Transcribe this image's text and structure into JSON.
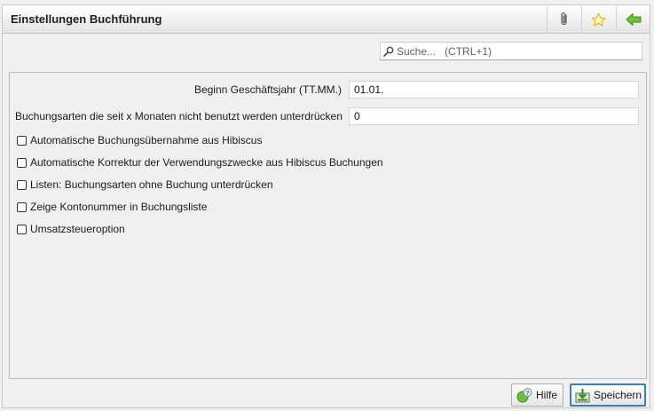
{
  "header": {
    "title": "Einstellungen Buchführung"
  },
  "icons": {
    "attach": "paperclip-icon",
    "bookmark": "star-icon",
    "back": "back-arrow-icon"
  },
  "search": {
    "placeholder": "Suche...   (CTRL+1)"
  },
  "form": {
    "fiscal_year_label": "Beginn Geschäftsjahr (TT.MM.)",
    "fiscal_year_value": "01.01.",
    "hide_unused_label": "Buchungsarten die seit x Monaten nicht benutzt werden unterdrücken",
    "hide_unused_value": "0",
    "checkboxes": [
      {
        "label": "Automatische Buchungsübernahme aus Hibiscus",
        "checked": false
      },
      {
        "label": "Automatische Korrektur der Verwendungszwecke aus Hibiscus Buchungen",
        "checked": false
      },
      {
        "label": "Listen: Buchungsarten ohne Buchung unterdrücken",
        "checked": false
      },
      {
        "label": "Zeige Kontonummer in Buchungsliste",
        "checked": false
      },
      {
        "label": "Umsatzsteueroption",
        "checked": false
      }
    ]
  },
  "footer": {
    "help_label": "Hilfe",
    "save_label": "Speichern"
  },
  "colors": {
    "accent": "#3c7fb1",
    "back_arrow": "#5cb82a",
    "star": "#e6b400"
  }
}
